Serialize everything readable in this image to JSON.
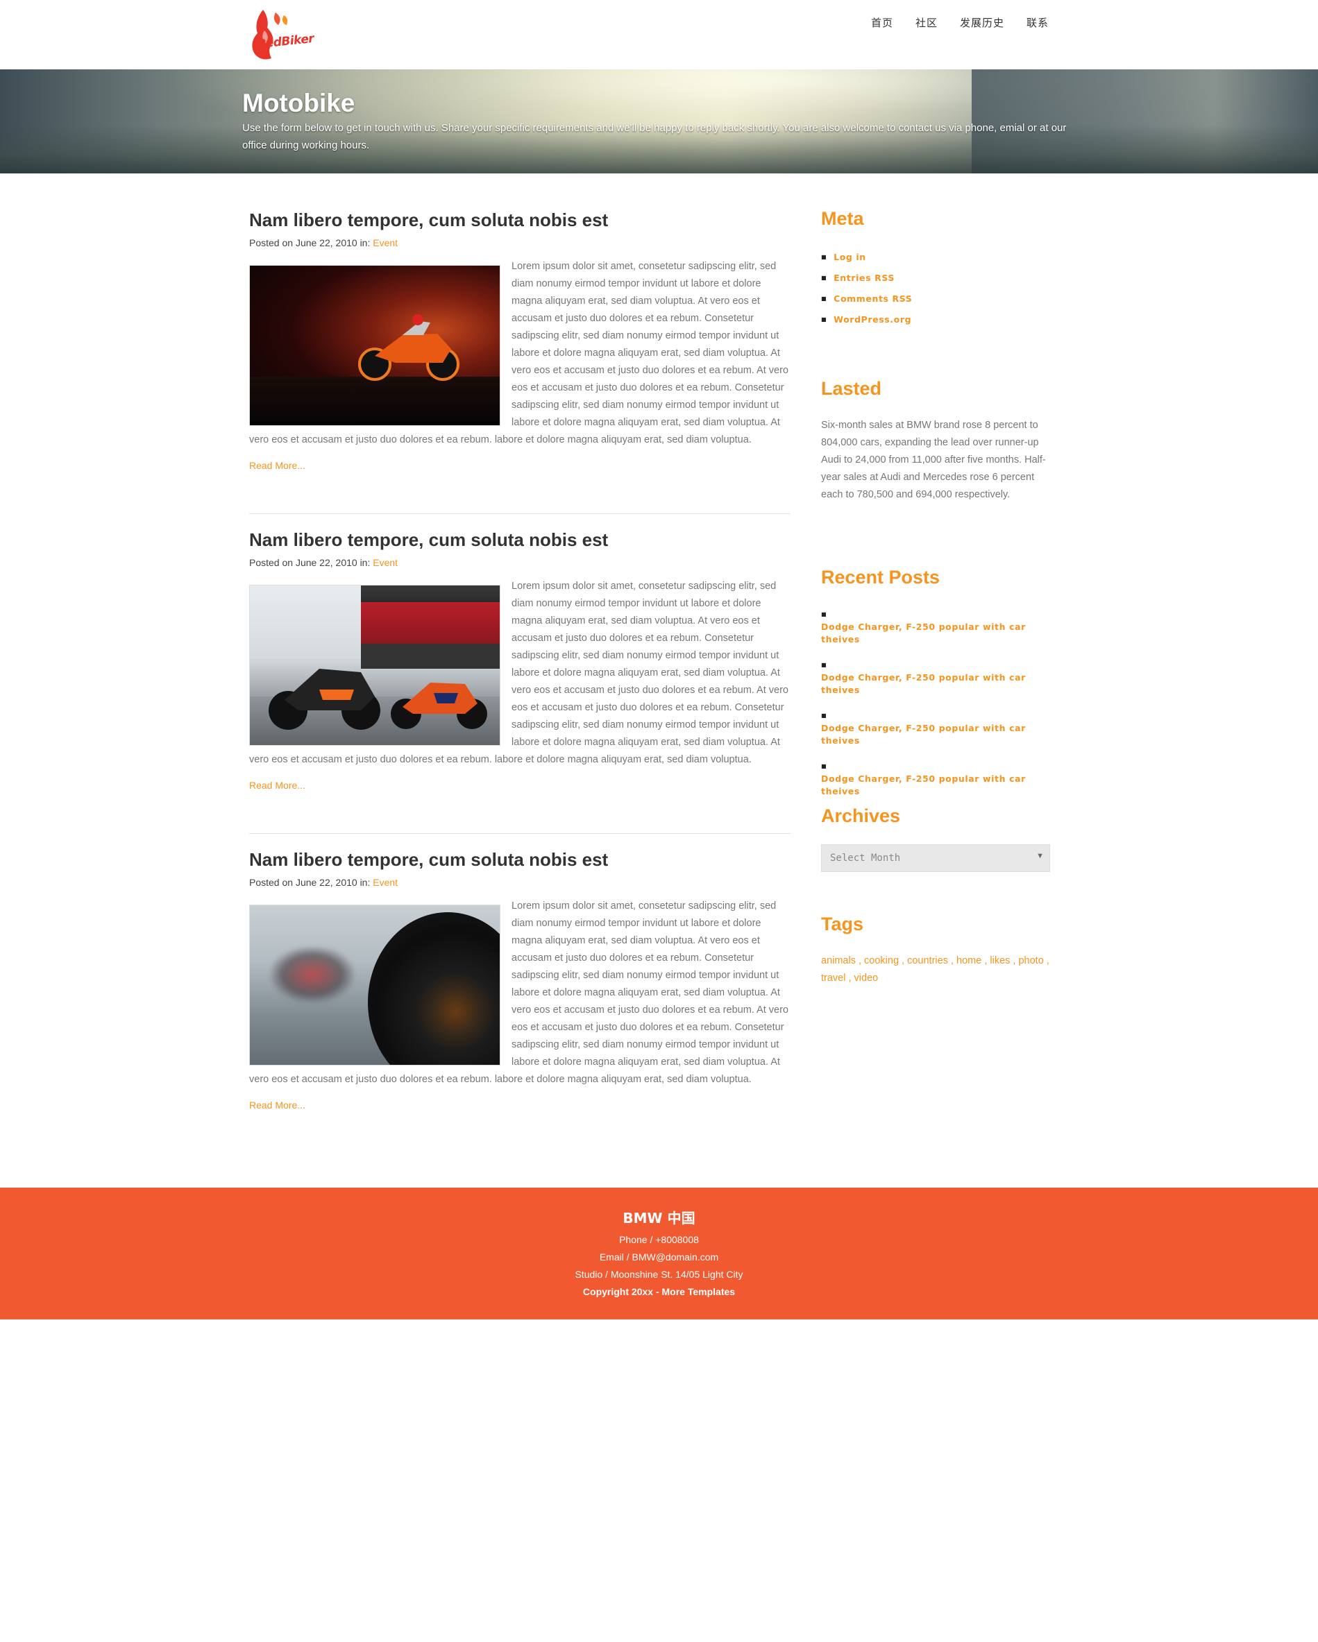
{
  "header": {
    "logo_text": "RedBiker",
    "nav": [
      "首页",
      "社区",
      "发展历史",
      "联系"
    ]
  },
  "banner": {
    "title": "Motobike",
    "text": "Use the form below to get in touch with us. Share your specific requirements and we'll be happy to reply back shortly. You are also welcome to contact us via phone, emial or at our office during working hours."
  },
  "posts": [
    {
      "title": "Nam libero tempore, cum soluta nobis est",
      "posted_prefix": "Posted on June 22, 2010 in: ",
      "category": "Event",
      "body": "Lorem ipsum dolor sit amet, consetetur sadipscing elitr, sed diam nonumy eirmod tempor invidunt ut labore et dolore magna aliquyam erat, sed diam voluptua. At vero eos et accusam et justo duo dolores et ea rebum. Consetetur sadipscing elitr, sed diam nonumy eirmod tempor invidunt ut labore et dolore magna aliquyam erat, sed diam voluptua. At vero eos et accusam et justo duo dolores et ea rebum. At vero eos et accusam et justo duo dolores et ea rebum. Consetetur sadipscing elitr, sed diam nonumy eirmod tempor invidunt ut labore et dolore magna aliquyam erat, sed diam voluptua. At vero eos et accusam et justo duo dolores et ea rebum. labore et dolore magna aliquyam erat, sed diam voluptua.",
      "read_more": "Read More..."
    },
    {
      "title": "Nam libero tempore, cum soluta nobis est",
      "posted_prefix": "Posted on June 22, 2010 in: ",
      "category": "Event",
      "body": "Lorem ipsum dolor sit amet, consetetur sadipscing elitr, sed diam nonumy eirmod tempor invidunt ut labore et dolore magna aliquyam erat, sed diam voluptua. At vero eos et accusam et justo duo dolores et ea rebum. Consetetur sadipscing elitr, sed diam nonumy eirmod tempor invidunt ut labore et dolore magna aliquyam erat, sed diam voluptua. At vero eos et accusam et justo duo dolores et ea rebum. At vero eos et accusam et justo duo dolores et ea rebum. Consetetur sadipscing elitr, sed diam nonumy eirmod tempor invidunt ut labore et dolore magna aliquyam erat, sed diam voluptua. At vero eos et accusam et justo duo dolores et ea rebum. labore et dolore magna aliquyam erat, sed diam voluptua.",
      "read_more": "Read More..."
    },
    {
      "title": "Nam libero tempore, cum soluta nobis est",
      "posted_prefix": "Posted on June 22, 2010 in: ",
      "category": "Event",
      "body": "Lorem ipsum dolor sit amet, consetetur sadipscing elitr, sed diam nonumy eirmod tempor invidunt ut labore et dolore magna aliquyam erat, sed diam voluptua. At vero eos et accusam et justo duo dolores et ea rebum. Consetetur sadipscing elitr, sed diam nonumy eirmod tempor invidunt ut labore et dolore magna aliquyam erat, sed diam voluptua. At vero eos et accusam et justo duo dolores et ea rebum. At vero eos et accusam et justo duo dolores et ea rebum. Consetetur sadipscing elitr, sed diam nonumy eirmod tempor invidunt ut labore et dolore magna aliquyam erat, sed diam voluptua. At vero eos et accusam et justo duo dolores et ea rebum. labore et dolore magna aliquyam erat, sed diam voluptua.",
      "read_more": "Read More..."
    }
  ],
  "sidebar": {
    "meta_title": "Meta",
    "meta_links": [
      "Log in",
      "Entries RSS",
      "Comments RSS",
      "WordPress.org"
    ],
    "lasted_title": "Lasted",
    "lasted_text": "Six-month sales at BMW brand rose 8 percent to 804,000 cars, expanding the lead over runner-up Audi to 24,000 from 11,000 after five months. Half-year sales at Audi and Mercedes rose 6 percent each to 780,500 and 694,000 respectively.",
    "recent_title": "Recent Posts",
    "recent_posts": [
      "Dodge Charger, F-250 popular with car theives",
      "Dodge Charger, F-250 popular with car theives",
      "Dodge Charger, F-250 popular with car theives",
      "Dodge Charger, F-250 popular with car theives"
    ],
    "archives_title": "Archives",
    "archives_select": "Select Month",
    "tags_title": "Tags",
    "tags_text": "animals , cooking , countries , home , likes , photo , travel , video"
  },
  "footer": {
    "brand": "BMW 中国",
    "phone": "Phone / +8008008",
    "email": "Email / BMW@domain.com",
    "address": "Studio / Moonshine St. 14/05 Light City",
    "copyright": "Copyright 20xx - More Templates"
  },
  "colors": {
    "accent": "#f7941d",
    "footer_bg": "#f15a31",
    "logo_red": "#e8352a"
  }
}
